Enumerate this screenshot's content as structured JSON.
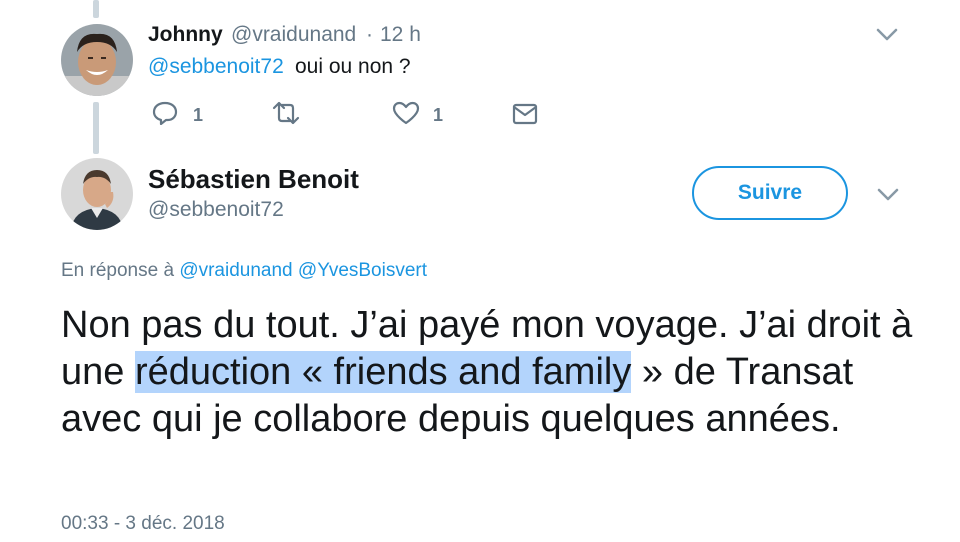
{
  "reply_tweet": {
    "name": "Johnny",
    "handle": "@vraidunand",
    "separator": "·",
    "time": "12 h",
    "mention": "@sebbenoit72",
    "text": "oui ou non ?",
    "actions": {
      "reply_count": "1",
      "retweet_count": "",
      "like_count": "1"
    }
  },
  "main_tweet": {
    "name": "Sébastien Benoit",
    "handle": "@sebbenoit72",
    "follow_label": "Suivre",
    "reply_prefix": "En réponse à",
    "reply_to": [
      "@vraidunand",
      "@YvesBoisvert"
    ],
    "text_before": "Non pas du tout. J’ai payé mon voyage. J’ai droit à une ",
    "text_highlight": "réduction « friends and family",
    "text_after": " » de Transat avec qui je collabore depuis quelques années.",
    "timestamp": "00:33 - 3 déc. 2018"
  },
  "colors": {
    "link": "#1b95e0",
    "muted": "#657786",
    "highlight": "#b3d4fc",
    "thread_line": "#ccd6dd"
  },
  "icons": {
    "reply": "reply-icon",
    "retweet": "retweet-icon",
    "like": "heart-icon",
    "dm": "envelope-icon",
    "caret": "chevron-down-icon"
  }
}
